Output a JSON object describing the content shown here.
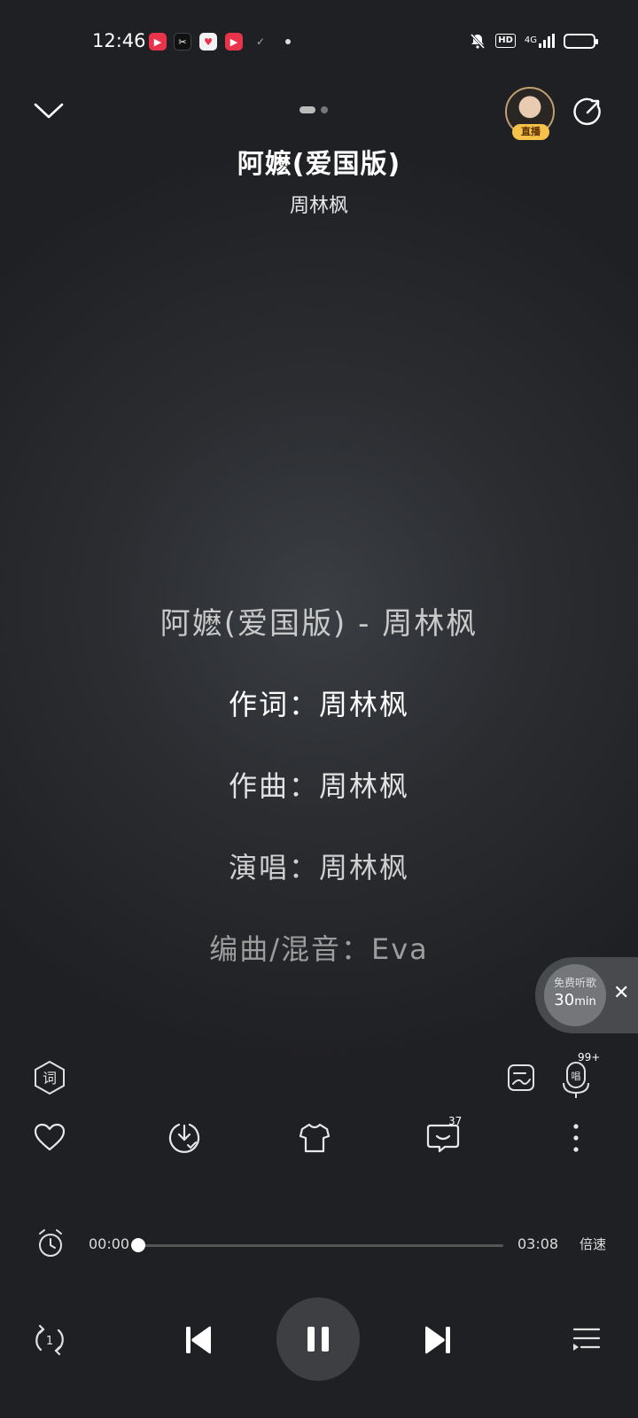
{
  "status_bar": {
    "time": "12:46",
    "hd": "HD",
    "network": "4G",
    "app_icons": [
      "video-app-icon",
      "capcut-icon",
      "heart-app-icon",
      "play-app-icon",
      "check-icon"
    ]
  },
  "header": {
    "page_indicator": {
      "count": 2,
      "active": 0
    },
    "live_badge": "直播"
  },
  "song": {
    "title": "阿嬷(爱国版)",
    "artist": "周林枫"
  },
  "lyrics": [
    "阿嬷(爱国版) - 周林枫",
    "作词：周林枫",
    "作曲：周林枫",
    "演唱：周林枫",
    "编曲/混音：Eva",
    "……"
  ],
  "free_listen": {
    "label": "免费听歌",
    "time_value": "30",
    "time_unit": "min"
  },
  "toolbar": {
    "sing_count": "99+",
    "comment_count": "37"
  },
  "progress": {
    "current": "00:00",
    "total": "03:08",
    "fraction": 0.0,
    "speed_label": "倍速"
  },
  "colors": {
    "background": "#2b2d31",
    "text": "#ffffff",
    "live_badge": "#f6c24a"
  }
}
